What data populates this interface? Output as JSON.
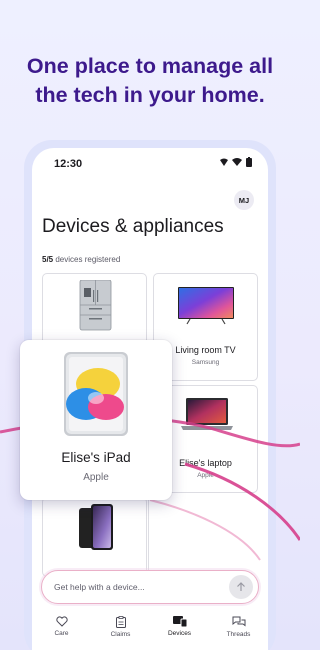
{
  "headline": {
    "line1": "One place to manage all",
    "line2": "the tech in your home."
  },
  "status_bar": {
    "time": "12:30",
    "icons": [
      "wifi-icon",
      "signal-icon",
      "battery-icon"
    ]
  },
  "header": {
    "avatar_initials": "MJ",
    "title": "Devices & appliances",
    "registered_count": "5/5",
    "registered_label": "devices registered"
  },
  "devices": [
    {
      "name": "",
      "brand": "",
      "icon": "refrigerator-icon"
    },
    {
      "name": "Living room TV",
      "brand": "Samsung",
      "icon": "tv-icon"
    },
    {
      "name": "Elise's laptop",
      "brand": "Apple",
      "icon": "laptop-icon"
    },
    {
      "name": "",
      "brand": "",
      "icon": "phone-icon"
    }
  ],
  "popup": {
    "name": "Elise's iPad",
    "brand": "Apple",
    "icon": "tablet-icon"
  },
  "help": {
    "placeholder": "Get help with a device...",
    "send_icon": "arrow-up-icon"
  },
  "nav": {
    "items": [
      {
        "label": "Care",
        "icon": "heart-icon"
      },
      {
        "label": "Claims",
        "icon": "clipboard-icon"
      },
      {
        "label": "Devices",
        "icon": "devices-icon",
        "active": true
      },
      {
        "label": "Threads",
        "icon": "chat-bubbles-icon"
      }
    ]
  },
  "colors": {
    "headline": "#3d1a8c",
    "accent_wave": "#d63f8c",
    "background": "#eceafd"
  }
}
